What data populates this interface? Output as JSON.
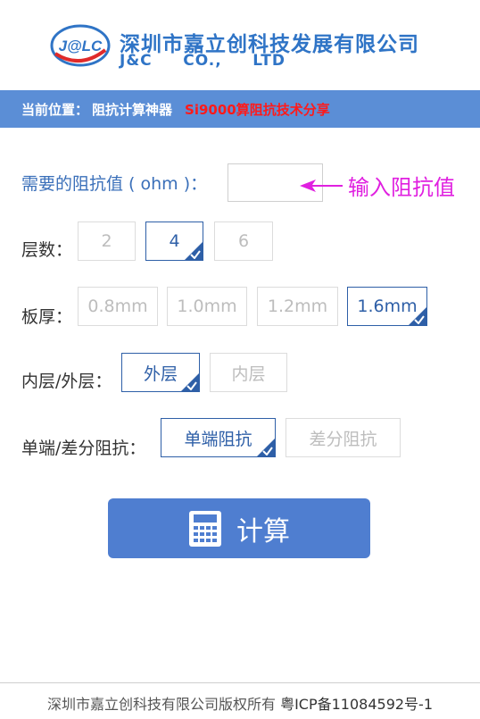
{
  "header": {
    "logo_text": "J@LC",
    "company_cn": "深圳市嘉立创科技发展有限公司",
    "company_en": "J&C     CO.,     LTD"
  },
  "breadcrumb": {
    "label": "当前位置：",
    "current": "阻抗计算神器",
    "link": "Si9000算阻抗技术分享"
  },
  "impedance": {
    "label": "需要的阻抗值 ( ohm )：",
    "value": "",
    "hint": "输入阻抗值"
  },
  "layers": {
    "label": "层数：",
    "options": [
      "2",
      "4",
      "6"
    ],
    "selected": "4"
  },
  "thickness": {
    "label": "板厚：",
    "options": [
      "0.8mm",
      "1.0mm",
      "1.2mm",
      "1.6mm"
    ],
    "selected": "1.6mm"
  },
  "layer_type": {
    "label": "内层/外层：",
    "options": [
      "外层",
      "内层"
    ],
    "selected": "外层"
  },
  "impedance_type": {
    "label": "单端/差分阻抗：",
    "options": [
      "单端阻抗",
      "差分阻抗"
    ],
    "selected": "单端阻抗"
  },
  "calc_button": {
    "label": "计算",
    "icon": "calculator-icon"
  },
  "footer": {
    "copyright": "深圳市嘉立创科技有限公司版权所有",
    "icp": "粤ICP备11084592号-1"
  },
  "colors": {
    "brand_blue": "#2f74c6",
    "breadcrumb_bg": "#5b8ed6",
    "selected_border": "#2e5fa7",
    "link_red": "#ff1a1a",
    "hint_magenta": "#e020e0",
    "button_bg": "#4f7ed0"
  }
}
